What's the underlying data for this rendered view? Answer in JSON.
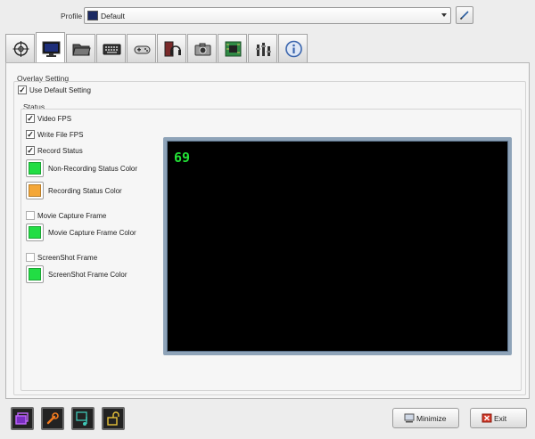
{
  "profile": {
    "label": "Profile",
    "value": "Default"
  },
  "tabs": [
    {
      "icon": "crosshair-icon"
    },
    {
      "icon": "monitor-icon",
      "active": true
    },
    {
      "icon": "folder-icon"
    },
    {
      "icon": "keyboard-icon"
    },
    {
      "icon": "gamepad-icon"
    },
    {
      "icon": "headset-icon"
    },
    {
      "icon": "camera-icon"
    },
    {
      "icon": "chip-icon"
    },
    {
      "icon": "tools-icon"
    },
    {
      "icon": "info-icon"
    }
  ],
  "overlay": {
    "title": "Overlay Setting",
    "use_default": {
      "label": "Use Default Setting",
      "checked": true
    }
  },
  "status": {
    "title": "Status",
    "video_fps": {
      "label": "Video FPS",
      "checked": true
    },
    "write_file_fps": {
      "label": "Write File FPS",
      "checked": true
    },
    "record_status": {
      "label": "Record Status",
      "checked": true
    },
    "non_recording_color": {
      "label": "Non-Recording Status Color",
      "color": "#22dd44"
    },
    "recording_color": {
      "label": "Recording Status Color",
      "color": "#f4a738"
    },
    "movie_capture_frame": {
      "label": "Movie Capture Frame",
      "checked": false
    },
    "movie_capture_color": {
      "label": "Movie Capture Frame Color",
      "color": "#22dd44"
    },
    "screenshot_frame": {
      "label": "ScreenShot Frame",
      "checked": false
    },
    "screenshot_color": {
      "label": "ScreenShot Frame Color",
      "color": "#22dd44"
    }
  },
  "preview": {
    "fps_value": "69",
    "fps_color": "#22e036"
  },
  "bottom": {
    "tools": [
      "window-icon",
      "wrench-icon",
      "music-icon",
      "unlock-icon"
    ],
    "minimize_label": "Minimize",
    "exit_label": "Exit"
  }
}
